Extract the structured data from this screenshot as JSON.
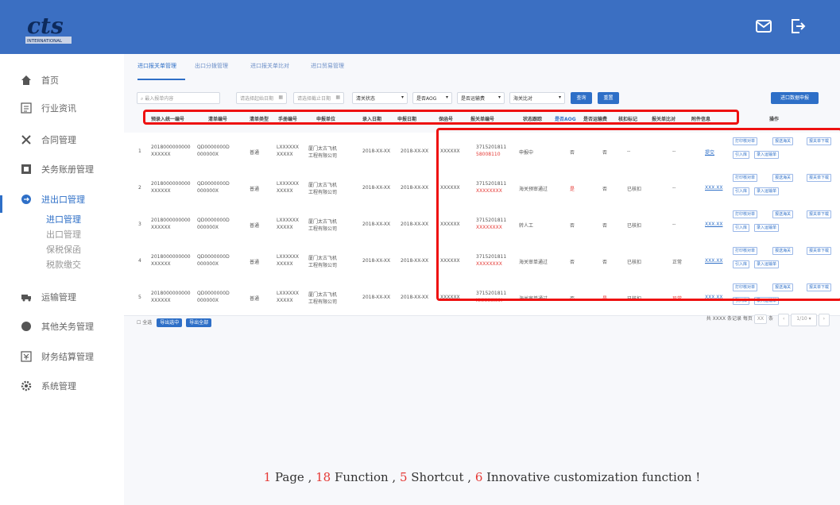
{
  "topbar": {
    "logo_text": "INTERNATIONAL",
    "logo_mark": "cts"
  },
  "sidebar": {
    "items": [
      {
        "label": "首页",
        "icon": "home-icon"
      },
      {
        "label": "行业资讯",
        "icon": "news-icon"
      },
      {
        "label": "合同管理",
        "icon": "contract-icon"
      },
      {
        "label": "关务账册管理",
        "icon": "ledger-icon"
      },
      {
        "label": "进出口管理",
        "icon": "import-export-icon"
      },
      {
        "label": "运输管理",
        "icon": "truck-icon"
      },
      {
        "label": "其他关务管理",
        "icon": "other-icon"
      },
      {
        "label": "财务结算管理",
        "icon": "finance-icon"
      },
      {
        "label": "系统管理",
        "icon": "settings-icon"
      }
    ],
    "subitems": [
      "进口管理",
      "出口管理",
      "保税保函",
      "税款缴交"
    ]
  },
  "tabs": [
    "进口报关单管理",
    "出口分拨管理",
    "进口报关单比对",
    "进口贸易管理"
  ],
  "filters": {
    "search_placeholder": "最入报单内容",
    "date_start": "请选择起始日期",
    "date_end": "请选择截止日期",
    "status": "清关状态",
    "aog": "是否AOG",
    "transfer": "是否运输费",
    "compare": "海关比对",
    "query_btn": "查询",
    "reset_btn": "重置",
    "apply_btn": "进口数据申报"
  },
  "table": {
    "headers": [
      "预录入统一编号",
      "清单编号",
      "清单类型",
      "手册编号",
      "申报单位",
      "录入日期",
      "申报日期",
      "保函号",
      "报关单编号",
      "状态跟踪",
      "是否AOG",
      "是否运输费",
      "核扣标记",
      "报关单比对",
      "附件信息"
    ],
    "op_header": "操作",
    "rows": [
      {
        "idx": "1",
        "pre": [
          "2018000000000",
          "XXXXXX"
        ],
        "no": [
          "QD0000000D",
          "000000X"
        ],
        "type": "普通",
        "manual": [
          "LXXXXXX",
          "XXXXX"
        ],
        "unit": [
          "厦门太古飞机",
          "工程有限公司"
        ],
        "entry": "2018-XX-XX",
        "decl": "2018-XX-XX",
        "guarantee": "XXXXXX",
        "customs": [
          "3715201811",
          "58008110"
        ],
        "status": "申报中",
        "aog": "否",
        "aog_red": false,
        "trans": "否",
        "trans_red": false,
        "mark": "--",
        "compare": "--",
        "compare_red": false,
        "attach": "提交"
      },
      {
        "idx": "2",
        "pre": [
          "2018000000000",
          "XXXXXX"
        ],
        "no": [
          "QD0000000D",
          "000000X"
        ],
        "type": "普通",
        "manual": [
          "LXXXXXX",
          "XXXXX"
        ],
        "unit": [
          "厦门太古飞机",
          "工程有限公司"
        ],
        "entry": "2018-XX-XX",
        "decl": "2018-XX-XX",
        "guarantee": "XXXXXX",
        "customs": [
          "3715201811",
          "XXXXXXXX"
        ],
        "status": "海关预审通过",
        "aog": "是",
        "aog_red": true,
        "trans": "否",
        "trans_red": false,
        "mark": "已核扣",
        "compare": "--",
        "compare_red": false,
        "attach": "XXX.XX"
      },
      {
        "idx": "3",
        "pre": [
          "2018000000000",
          "XXXXXX"
        ],
        "no": [
          "QD0000000D",
          "000000X"
        ],
        "type": "普通",
        "manual": [
          "LXXXXXX",
          "XXXXX"
        ],
        "unit": [
          "厦门太古飞机",
          "工程有限公司"
        ],
        "entry": "2018-XX-XX",
        "decl": "2018-XX-XX",
        "guarantee": "XXXXXX",
        "customs": [
          "3715201811",
          "XXXXXXXX"
        ],
        "status": "转人工",
        "aog": "否",
        "aog_red": false,
        "trans": "否",
        "trans_red": false,
        "mark": "已核扣",
        "compare": "--",
        "compare_red": false,
        "attach": "XXX.XX"
      },
      {
        "idx": "4",
        "pre": [
          "2018000000000",
          "XXXXXX"
        ],
        "no": [
          "QD0000000D",
          "000000X"
        ],
        "type": "普通",
        "manual": [
          "LXXXXXX",
          "XXXXX"
        ],
        "unit": [
          "厦门太古飞机",
          "工程有限公司"
        ],
        "entry": "2018-XX-XX",
        "decl": "2018-XX-XX",
        "guarantee": "XXXXXX",
        "customs": [
          "3715201811",
          "XXXXXXXX"
        ],
        "status": "海关审单通过",
        "aog": "否",
        "aog_red": false,
        "trans": "否",
        "trans_red": false,
        "mark": "已核扣",
        "compare": "正常",
        "compare_red": false,
        "attach": "XXX.XX"
      },
      {
        "idx": "5",
        "pre": [
          "2018000000000",
          "XXXXXX"
        ],
        "no": [
          "QD0000000D",
          "000000X"
        ],
        "type": "普通",
        "manual": [
          "LXXXXXX",
          "XXXXX"
        ],
        "unit": [
          "厦门太古飞机",
          "工程有限公司"
        ],
        "entry": "2018-XX-XX",
        "decl": "2018-XX-XX",
        "guarantee": "XXXXXX",
        "customs": [
          "3715201811",
          "XXXXXXXX"
        ],
        "status": "海关审单通过",
        "aog": "否",
        "aog_red": false,
        "trans": "是",
        "trans_red": true,
        "mark": "已核扣",
        "compare": "异常",
        "compare_red": true,
        "attach": "XXX.XX"
      }
    ],
    "ops": [
      "打印核对单",
      "报送海关",
      "报关单下载",
      "引入库",
      "录入运输单"
    ]
  },
  "footer": {
    "select_all": "全选",
    "export_btn": "导出选中",
    "export_all_btn": "导出全部",
    "summary": "共 XXXX 条记录 每页",
    "per_page": "XX",
    "unit": "条",
    "page": "1/10"
  },
  "caption": {
    "n1": "1",
    "t1": " Page ,  ",
    "n2": "18",
    "t2": " Function ,  ",
    "n3": "5",
    "t3": " Shortcut ,  ",
    "n4": "6",
    "t4": " Innovative customization function !"
  }
}
